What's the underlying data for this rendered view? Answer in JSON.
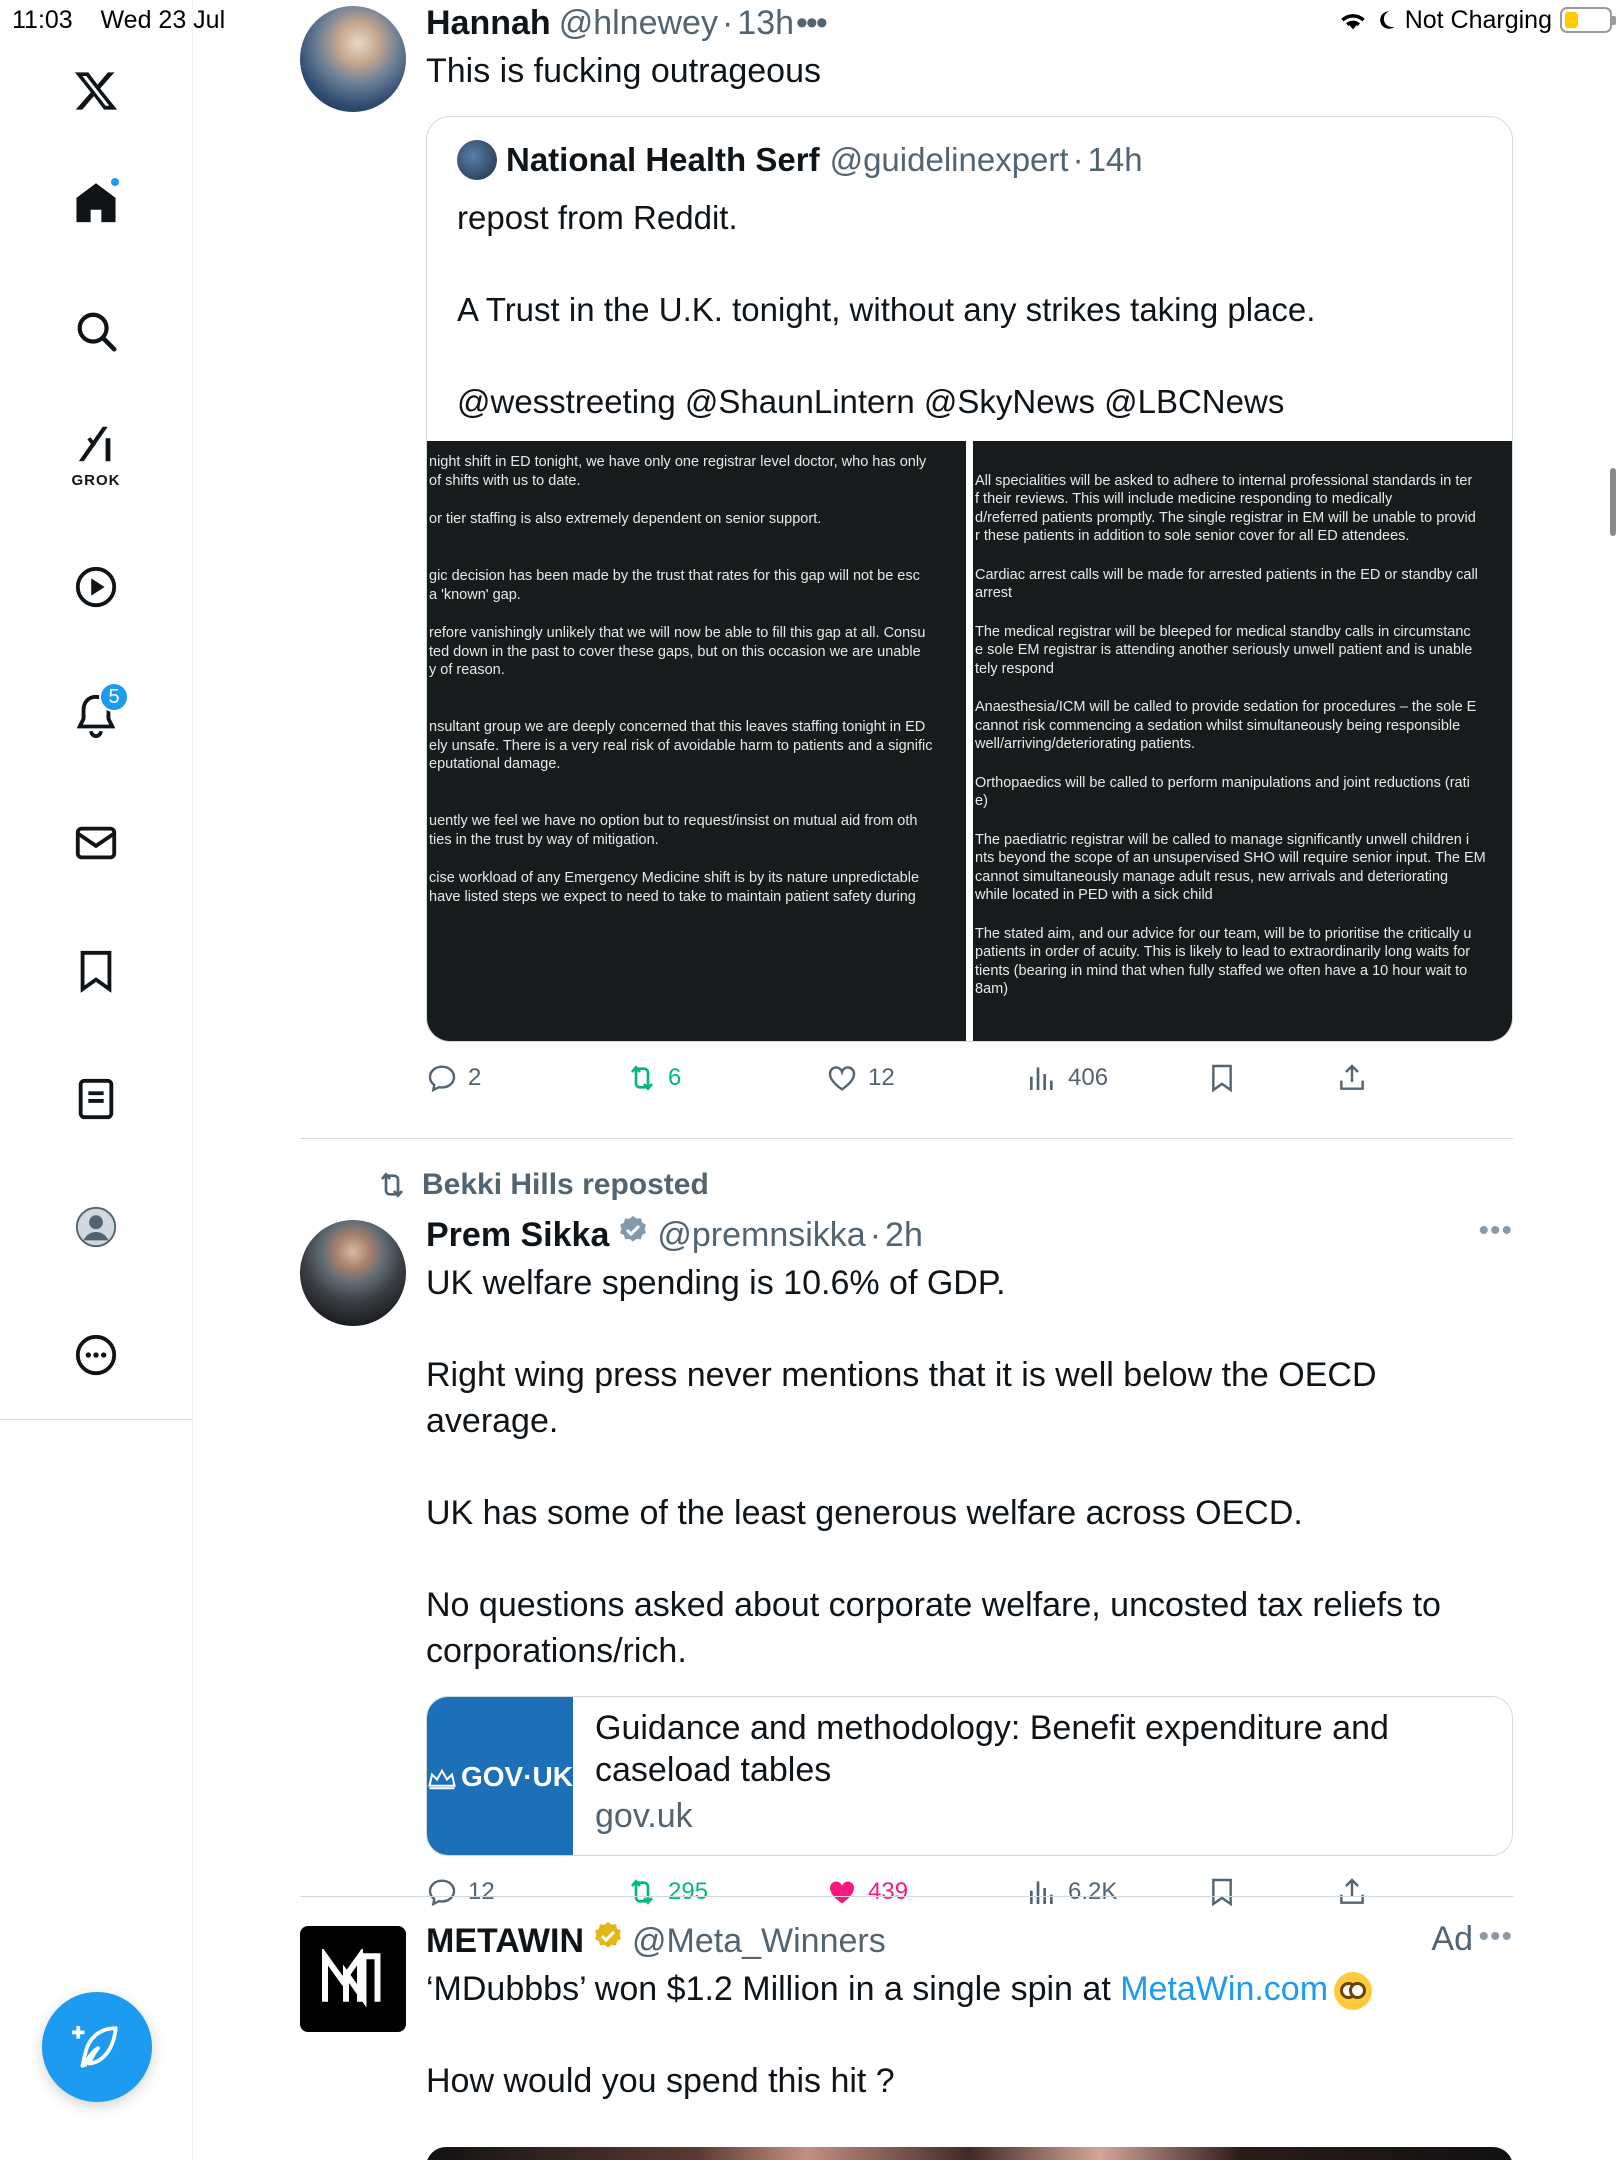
{
  "status_bar": {
    "time": "11:03",
    "date": "Wed 23 Jul",
    "charging": "Not Charging",
    "battery_level": 0.3
  },
  "sidebar": {
    "items": [
      {
        "name": "x-logo",
        "icon": "x-logo-icon"
      },
      {
        "name": "home",
        "icon": "home-icon",
        "has_dot": true
      },
      {
        "name": "explore",
        "icon": "search-icon"
      },
      {
        "name": "grok",
        "icon": "grok-icon",
        "label": "GROK"
      },
      {
        "name": "videos",
        "icon": "play-icon"
      },
      {
        "name": "notifications",
        "icon": "bell-icon",
        "badge": "5"
      },
      {
        "name": "messages",
        "icon": "mail-icon"
      },
      {
        "name": "bookmarks",
        "icon": "bookmark-icon"
      },
      {
        "name": "lists",
        "icon": "list-icon"
      },
      {
        "name": "profile",
        "icon": "profile-icon"
      },
      {
        "name": "more",
        "icon": "more-icon"
      }
    ],
    "compose_icon": "compose-icon"
  },
  "tweets": [
    {
      "name": "Hannah",
      "handle": "@hlnewey",
      "time": "13h",
      "text": "This is fucking outrageous",
      "quote": {
        "name": "National Health Serf",
        "handle": "@guidelinexpert",
        "time": "14h",
        "paragraphs": [
          "repost from Reddit.",
          "",
          "A Trust in the U.K. tonight, without any strikes taking place.",
          "",
          "@wesstreeting @ShaunLintern @SkyNews @LBCNews"
        ],
        "media_left": [
          "night shift in ED tonight, we have only one registrar level doctor, who has only\n of shifts with us to date.",
          "or tier staffing is also  extremely dependent on senior support.",
          "\ngic decision has been made by the trust that rates for this gap will not be esc\na 'known' gap.",
          "refore vanishingly unlikely that we will now be able to fill this gap at all. Consu\nted down in the past to cover these gaps, but on this occasion we are unable\ny of reason.",
          "\nnsultant group we are deeply concerned that this leaves staffing tonight in ED\nely unsafe. There is a very real risk of avoidable harm to patients and a signific\neputational damage.",
          "\nuently we feel we have no option but to request/insist on mutual aid from oth\nties in the trust by way of mitigation.",
          "cise workload of any Emergency Medicine shift is by its nature unpredictable\n have listed steps we expect to need to take to maintain patient safety during"
        ],
        "media_right": [
          "\nAll specialities will be asked to adhere to internal professional standards in ter\nf their reviews. This will include medicine responding to medically\nd/referred patients promptly. The single registrar in EM will be unable to provid\nr these patients in addition to sole senior cover for all ED attendees.",
          "Cardiac arrest calls will be made for arrested patients in the ED or standby call\narrest",
          "The medical registrar will be bleeped for medical standby calls in circumstanc\ne sole EM registrar is attending another seriously unwell patient and is unable\ntely respond",
          "Anaesthesia/ICM will be called to provide sedation for procedures – the sole E\n cannot risk commencing a sedation whilst simultaneously being responsible\nwell/arriving/deteriorating patients.",
          "Orthopaedics will be called to perform manipulations and joint reductions (rati\ne)",
          "The paediatric registrar will be called to manage significantly unwell children i\nnts beyond the scope of an unsupervised SHO will require senior input. The EM\n cannot simultaneously manage adult resus, new arrivals and deteriorating\n while located in PED with a sick child",
          "The stated aim, and our advice for our team, will be to prioritise the critically u\npatients in order of acuity. This is likely to lead to extraordinarily long waits for\ntients (bearing in mind that when fully staffed we often have a 10 hour wait to\n8am)"
        ]
      },
      "stats": {
        "replies": "2",
        "reposts": "6",
        "likes": "12",
        "views": "406"
      }
    },
    {
      "repost_by": "Bekki Hills reposted",
      "name": "Prem Sikka",
      "handle": "@premnsikka",
      "time": "2h",
      "verified": true,
      "paragraphs": [
        "UK welfare spending is 10.6% of GDP.",
        "",
        "Right wing press never mentions that it is well below the OECD average.",
        "",
        "UK has some of the least generous welfare across OECD.",
        "",
        "No questions asked about corporate welfare, uncosted tax reliefs to corporations/rich."
      ],
      "card": {
        "thumb_text": "GOV·UK",
        "title": "Guidance and methodology: Benefit expenditure and caseload tables",
        "domain": "gov.uk"
      },
      "stats": {
        "replies": "12",
        "reposts": "295",
        "likes": "439",
        "views": "6.2K"
      },
      "liked": true
    },
    {
      "name": "METAWIN",
      "handle": "@Meta_Winners",
      "verified": true,
      "ad_label": "Ad",
      "text_pre": "‘MDubbbs’ won $1.2 Million in a single spin at ",
      "link": "MetaWin.com",
      "paragraph2": "How would you spend this hit ?"
    }
  ],
  "colors": {
    "accent": "#1d9bf0",
    "repost_green": "#00ba7c",
    "like_pink": "#f91880",
    "gold_verified": "#e2b719"
  }
}
